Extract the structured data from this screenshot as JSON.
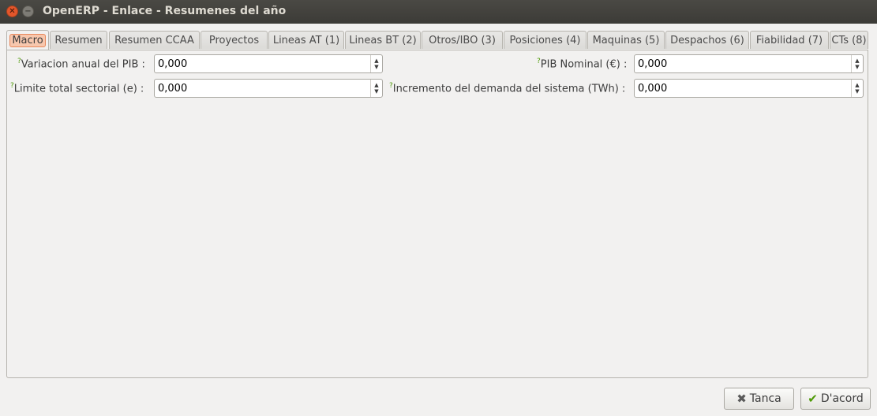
{
  "window": {
    "title": "OpenERP - Enlace - Resumenes del año"
  },
  "tabs": [
    {
      "label": "Macro",
      "active": true
    },
    {
      "label": "Resumen"
    },
    {
      "label": "Resumen CCAA"
    },
    {
      "label": "Proyectos"
    },
    {
      "label": "Lineas AT (1)"
    },
    {
      "label": "Lineas BT (2)"
    },
    {
      "label": "Otros/IBO (3)"
    },
    {
      "label": "Posiciones (4)"
    },
    {
      "label": "Maquinas (5)"
    },
    {
      "label": "Despachos (6)"
    },
    {
      "label": "Fiabilidad (7)"
    },
    {
      "label": "CTs (8)"
    }
  ],
  "form": {
    "help_mark": "?",
    "variacion_pib": {
      "label": "Variacion anual del PIB :",
      "value": "0,000"
    },
    "pib_nominal": {
      "label": "PIB Nominal (€) :",
      "value": "0,000"
    },
    "limite_sectorial": {
      "label": "Limite total sectorial (e) :",
      "value": "0,000"
    },
    "incremento_demanda": {
      "label": "Incremento del demanda del sistema (TWh) :",
      "value": "0,000"
    }
  },
  "buttons": {
    "cancel": "Tanca",
    "ok": "D'acord"
  },
  "icons": {
    "close": "close-icon",
    "minimize": "minimize-icon",
    "spin_up": "▲",
    "spin_down": "▼",
    "cancel": "✖",
    "ok": "✔"
  },
  "colors": {
    "titlebar": "#3c3b37",
    "active_tab_highlight": "#f7c7ad",
    "help_mark": "#4e9a06",
    "ok_icon": "#4e9a06"
  }
}
